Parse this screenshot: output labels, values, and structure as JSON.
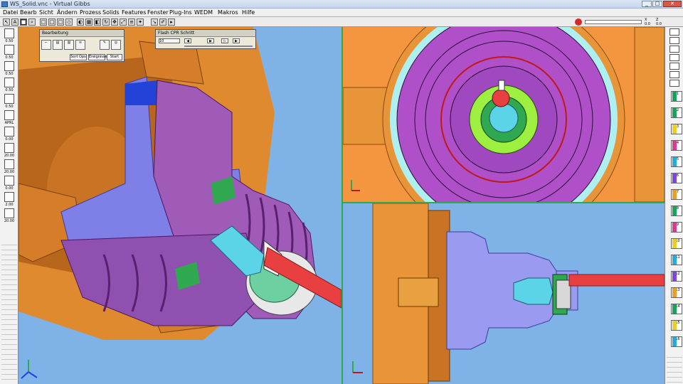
{
  "window": {
    "title": "WS_Solid.vnc - Virtual Gibbs"
  },
  "menu": [
    "Datei",
    "Bearb",
    "Sicht",
    "Ändern",
    "Prozess",
    "Solids",
    "Features",
    "Fenster",
    "Plug-Ins",
    "WEDM",
    "Makros",
    "Hilfe"
  ],
  "toolbar_readout": {
    "x_label": "X",
    "x_value": "0.0",
    "z_label": "Z",
    "z_value": "0.0"
  },
  "palette_bearbeitung": {
    "title": "Bearbeitung",
    "buttons": [
      "Sort Ops",
      "Ereignisse",
      "Start"
    ]
  },
  "palette_flash": {
    "title": "Flash CPR Schritt",
    "value": "10"
  },
  "left_tools": [
    {
      "label": "0.50"
    },
    {
      "label": "0.50"
    },
    {
      "label": "0.50"
    },
    {
      "label": "0.50"
    },
    {
      "label": "0.50"
    },
    {
      "label": "APRL"
    },
    {
      "label": "0.00"
    },
    {
      "label": "20.00"
    },
    {
      "label": "20.00"
    },
    {
      "label": "0.00"
    },
    {
      "label": "2.00"
    },
    {
      "label": "20.00"
    }
  ],
  "turret": [
    {
      "label": "T1"
    },
    {
      "label": "T2"
    },
    {
      "label": "T3"
    },
    {
      "label": "T4"
    },
    {
      "label": "T5"
    },
    {
      "label": "T6"
    },
    {
      "label": "T7"
    },
    {
      "label": "T8"
    },
    {
      "label": "T9"
    },
    {
      "label": "T10"
    },
    {
      "label": "T11"
    },
    {
      "label": "T12"
    },
    {
      "label": "T13"
    },
    {
      "label": "T14"
    },
    {
      "label": "T15"
    },
    {
      "label": "T16"
    }
  ],
  "turret_colors": [
    "#1ca05c",
    "#1ca05c",
    "#e8d02c",
    "#d83c8c",
    "#2aa8d8",
    "#7a4ad0",
    "#e8a02c",
    "#1ca05c",
    "#d83c8c",
    "#e8d02c",
    "#2aa8d8",
    "#7a4ad0",
    "#e8a02c",
    "#1ca05c",
    "#e8d02c",
    "#2aa8d8"
  ],
  "colors": {
    "viewport_bg": "#7fb3e8",
    "part_purple": "#a05ab8",
    "part_lavender": "#7f7fe8",
    "chuck_orange": "#e89438",
    "tool_red": "#e84040",
    "tool_cyan": "#5cd4e8",
    "insert_green": "#2fa84f"
  }
}
